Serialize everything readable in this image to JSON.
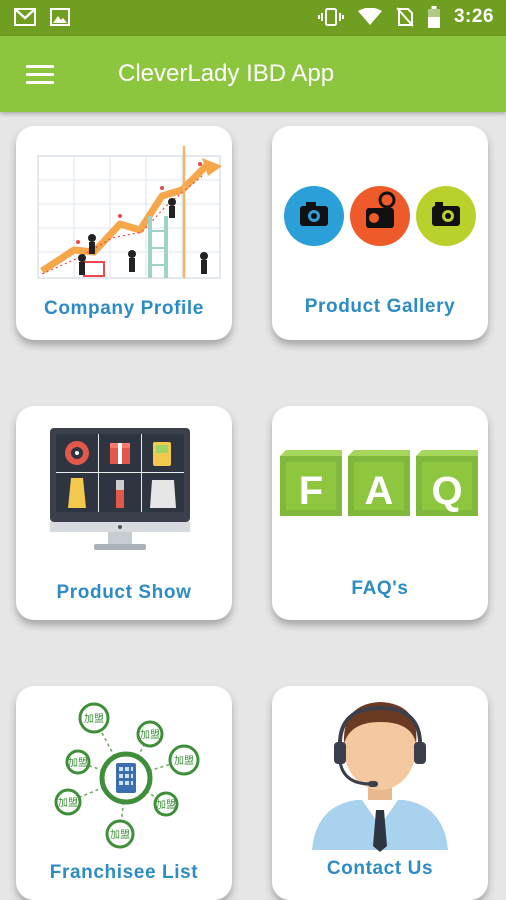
{
  "status_bar": {
    "time": "3:26",
    "left_icons": [
      "gmail-icon",
      "image-icon"
    ],
    "right_icons": [
      "vibrate-icon",
      "wifi-icon",
      "no-sim-icon",
      "battery-icon"
    ]
  },
  "app_bar": {
    "title": "CleverLady IBD App",
    "menu_icon": "hamburger-menu-icon"
  },
  "colors": {
    "status_bar": "#6f9e21",
    "app_bar": "#8cc63f",
    "label_blue": "#2d8cc4",
    "background": "#e6e6e6"
  },
  "cards": [
    {
      "label": "Company Profile",
      "icon": "growth-chart-icon"
    },
    {
      "label": "Product Gallery",
      "icon": "camera-icons"
    },
    {
      "label": "Product Show",
      "icon": "monitor-products-icon"
    },
    {
      "label": "FAQ's",
      "icon": "faq-blocks-icon"
    },
    {
      "label": "Franchisee List",
      "icon": "network-icon"
    },
    {
      "label": "Contact Us",
      "icon": "support-agent-icon"
    }
  ],
  "faq_letters": [
    "F",
    "A",
    "Q"
  ],
  "network_node_text": "加盟"
}
